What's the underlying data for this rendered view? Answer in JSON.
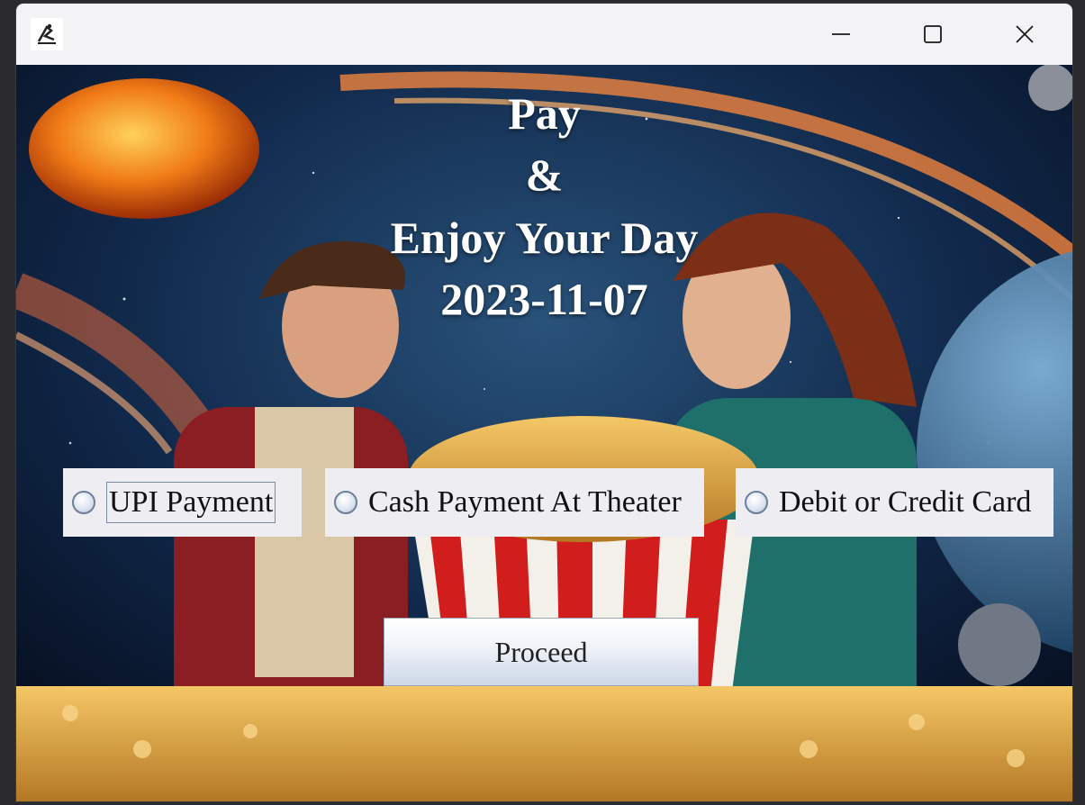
{
  "window": {
    "app_icon": "java-duke-icon",
    "controls": [
      "minimize-icon",
      "maximize-icon",
      "close-icon"
    ]
  },
  "headline": {
    "line1": "Pay",
    "line2": "&",
    "line3": "Enjoy Your Day",
    "date": "2023-11-07"
  },
  "payment_options": [
    {
      "label": "UPI Payment",
      "selected": false,
      "focused": true
    },
    {
      "label": "Cash Payment At Theater",
      "selected": false,
      "focused": false
    },
    {
      "label": "Debit or Credit Card",
      "selected": false,
      "focused": false
    }
  ],
  "proceed_label": "Proceed",
  "colors": {
    "titlebar": "#f3f3f5",
    "space": "#0b1a2e",
    "card_bg": "#eeeef2",
    "headline_text": "#ffffff"
  }
}
